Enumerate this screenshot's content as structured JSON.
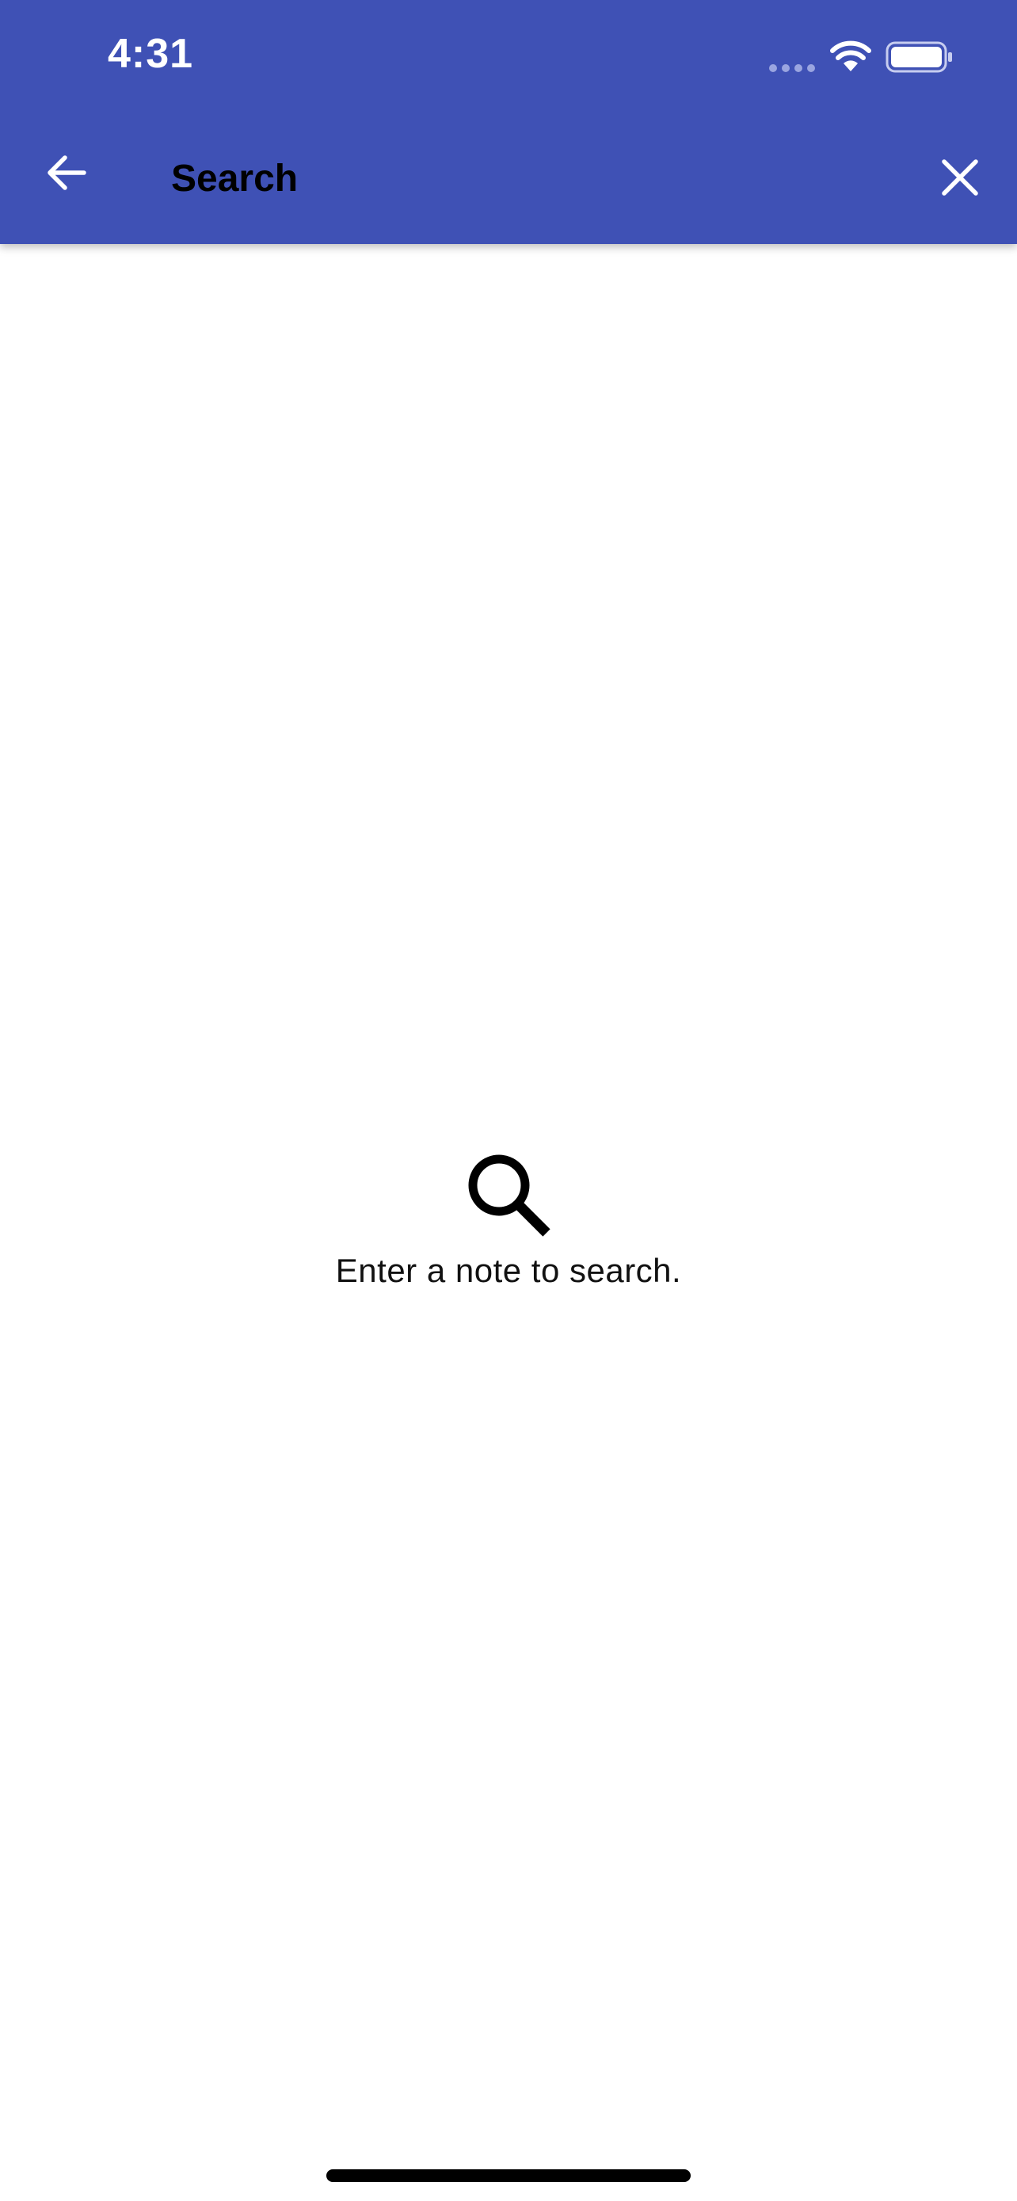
{
  "status_bar": {
    "time": "4:31"
  },
  "toolbar": {
    "title": "Search",
    "back_icon": "arrow-left-icon",
    "close_icon": "close-icon"
  },
  "empty_state": {
    "icon": "search-icon",
    "message": "Enter a note to search."
  },
  "colors": {
    "appbar": "#3f51b5",
    "background": "#ffffff"
  }
}
